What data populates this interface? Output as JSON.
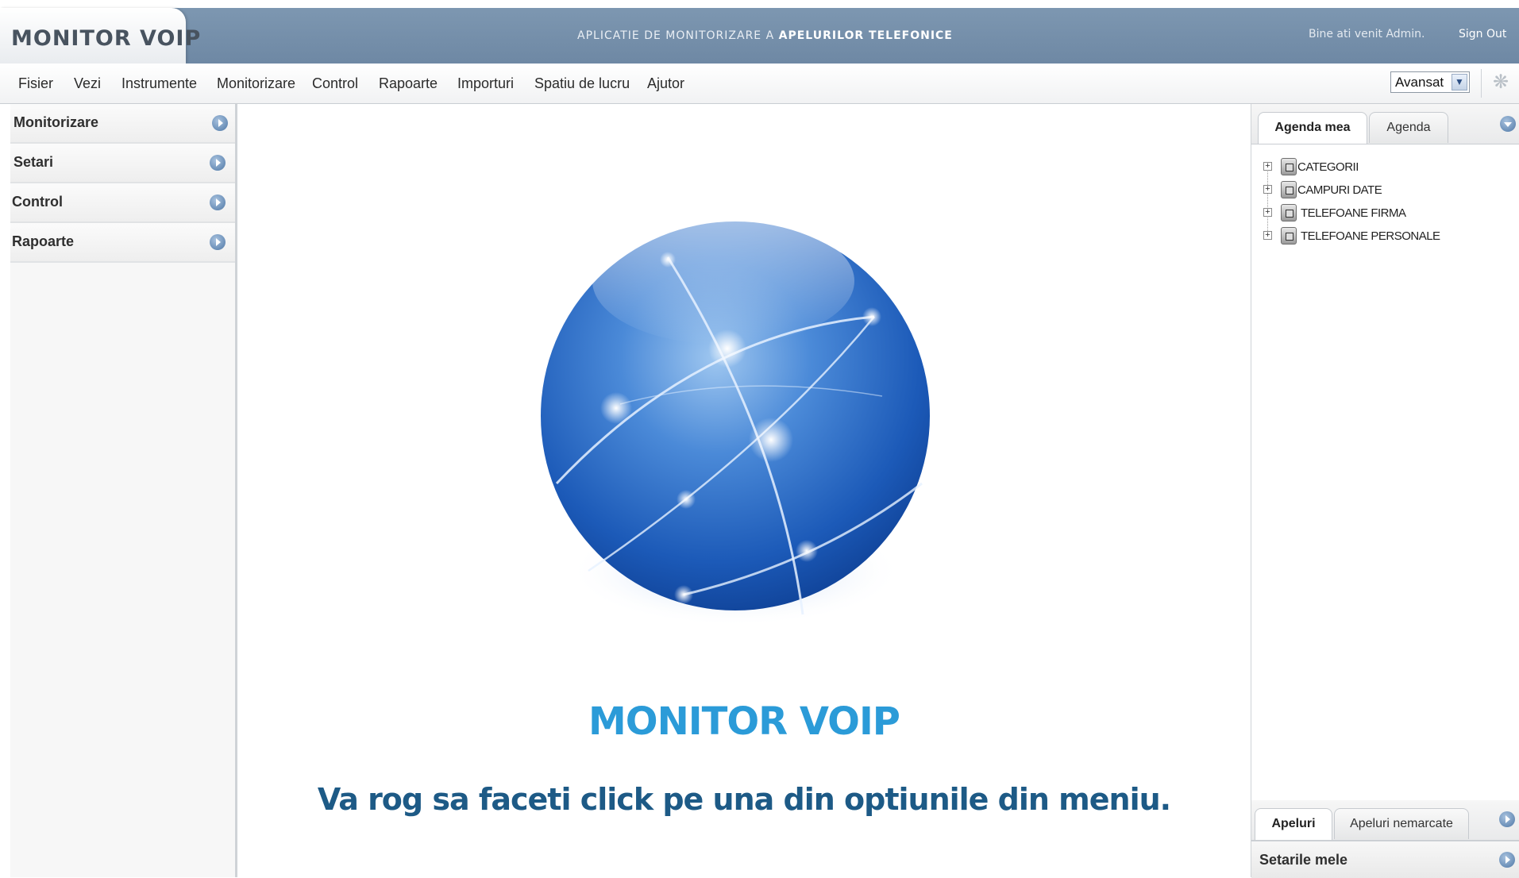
{
  "header": {
    "logo": "MONITOR VOIP",
    "subtitle_prefix": "APLICATIE DE MONITORIZARE A ",
    "subtitle_bold": "APELURILOR TELEFONICE",
    "welcome": "Bine ati venit Admin.",
    "sign_out": "Sign Out"
  },
  "menubar": {
    "items": [
      "Fisier",
      "Vezi",
      "Instrumente",
      "Monitorizare",
      "Control",
      "Rapoarte",
      "Importuri",
      "Spatiu de lucru",
      "Ajutor"
    ],
    "mode_select": {
      "value": "Avansat"
    },
    "spinner_icon": "loading-spinner-icon"
  },
  "sidebar": {
    "items": [
      {
        "label": "Monitorizare",
        "icon": "arrow-right-icon"
      },
      {
        "label": "Setari",
        "icon": "arrow-right-icon"
      },
      {
        "label": "Control",
        "icon": "arrow-right-icon"
      },
      {
        "label": "Rapoarte",
        "icon": "arrow-right-icon"
      }
    ]
  },
  "main": {
    "image": "globe-logo",
    "title": "MONITOR VOIP",
    "instruction": "Va rog sa faceti click pe una din optiunile din meniu."
  },
  "right_panel": {
    "top_tabs": [
      "Agenda mea",
      "Agenda"
    ],
    "active_top_tab": "Agenda mea",
    "tree": [
      {
        "label": "CATEGORII",
        "icon": "folder-node-icon"
      },
      {
        "label": "CAMPURI DATE",
        "icon": "folder-node-icon"
      },
      {
        "label": "TELEFOANE FIRMA",
        "icon": "folder-node-icon"
      },
      {
        "label": "TELEFOANE PERSONALE",
        "icon": "folder-node-icon"
      }
    ],
    "bottom_tabs": [
      "Apeluri",
      "Apeluri nemarcate"
    ],
    "active_bottom_tab": "Apeluri",
    "settings_label": "Setarile mele"
  },
  "colors": {
    "header_bg": "#7390ad",
    "brand_title": "#2b9bd8",
    "instruction": "#1d5a86",
    "arrow_button": "#4e77a6"
  }
}
